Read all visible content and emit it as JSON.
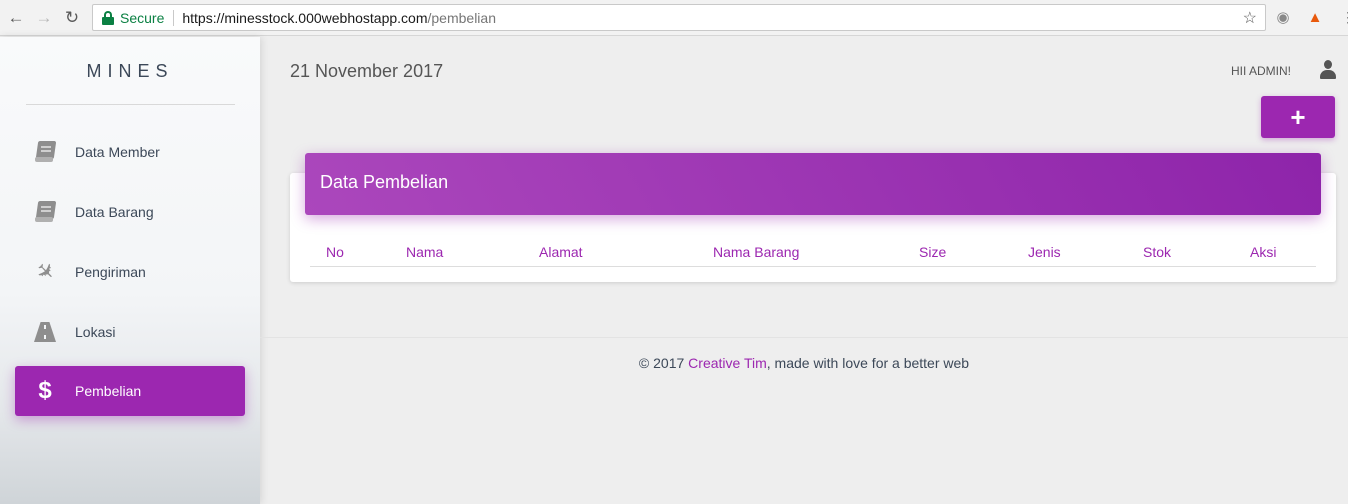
{
  "browser": {
    "secure_label": "Secure",
    "url_main": "https://minesstock.000webhostapp.com",
    "url_path": "/pembelian"
  },
  "sidebar": {
    "brand": "MINES",
    "items": [
      {
        "label": "Data Member",
        "icon": "book-icon"
      },
      {
        "label": "Data Barang",
        "icon": "book-icon"
      },
      {
        "label": "Pengiriman",
        "icon": "plane-icon"
      },
      {
        "label": "Lokasi",
        "icon": "road-icon"
      },
      {
        "label": "Pembelian",
        "icon": "dollar-icon",
        "active": true
      }
    ]
  },
  "header": {
    "date": "21 November 2017",
    "greeting": "HII ADMIN!"
  },
  "card": {
    "title": "Data Pembelian",
    "columns": [
      "No",
      "Nama",
      "Alamat",
      "Nama Barang",
      "Size",
      "Jenis",
      "Stok",
      "Aksi"
    ]
  },
  "footer": {
    "prefix": "© 2017 ",
    "link": "Creative Tim",
    "suffix": ", made with love for a better web"
  },
  "colors": {
    "accent": "#9c27b0",
    "secure": "#0b8043"
  }
}
